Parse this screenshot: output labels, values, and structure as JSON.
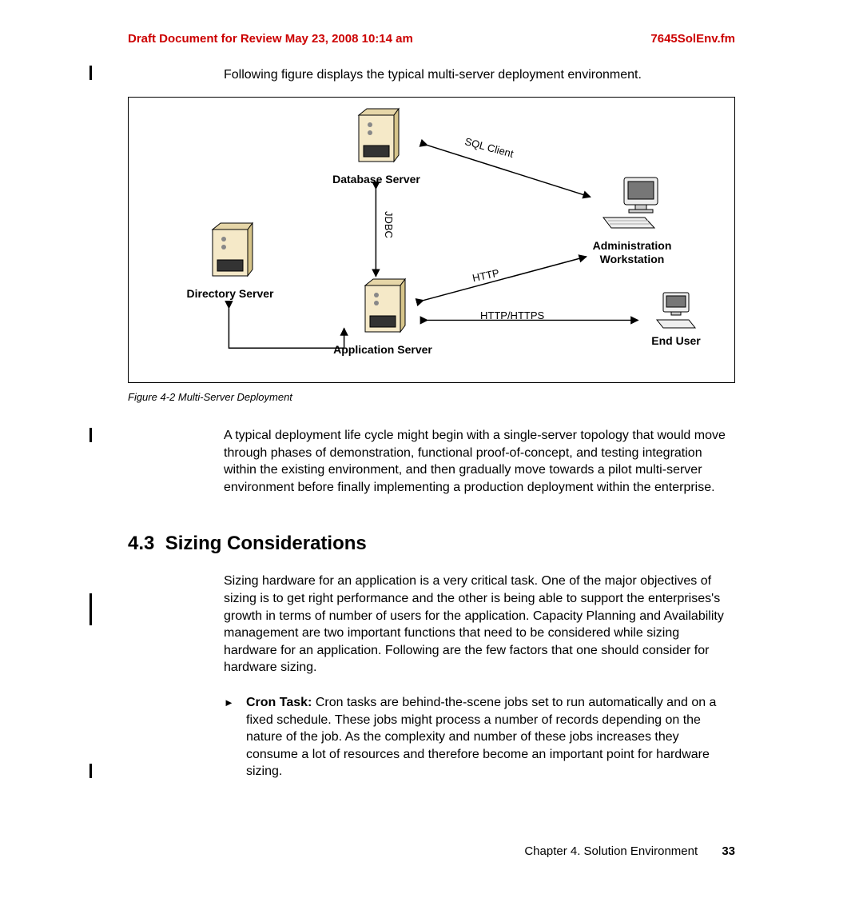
{
  "header": {
    "draft_notice": "Draft Document for Review May 23, 2008 10:14 am",
    "filename": "7645SolEnv.fm"
  },
  "intro": "Following figure displays the typical multi-server deployment environment.",
  "figure": {
    "nodes": {
      "db_server": "Database Server",
      "directory_server": "Directory Server",
      "app_server": "Application Server",
      "admin_ws_line1": "Administration",
      "admin_ws_line2": "Workstation",
      "end_user": "End User"
    },
    "connections": {
      "sql_client": "SQL Client",
      "jdbc": "JDBC",
      "http": "HTTP",
      "http_https": "HTTP/HTTPS"
    },
    "caption": "Figure 4-2   Multi-Server Deployment"
  },
  "para2": "A typical deployment life cycle might begin with a single-server topology that would move through phases of demonstration, functional proof-of-concept, and testing integration within the existing environment, and then gradually move towards a pilot multi-server environment before finally implementing a production deployment within the enterprise.",
  "section": {
    "number": "4.3",
    "title": "Sizing Considerations"
  },
  "para3": "Sizing hardware for an application is a very critical task. One of the major objectives of sizing is to get right performance and the other is being able to support the enterprises's growth in terms of number of users for the application. Capacity Planning and Availability management are two important functions that need to be considered while sizing hardware for an application. Following are the few factors that one should consider for hardware sizing.",
  "bullet1": {
    "bold": "Cron Task:",
    "text": " Cron tasks are behind-the-scene jobs set to run automatically and on a fixed schedule. These jobs might process a number of records depending on the nature of the job. As the complexity and number of these jobs increases they consume a lot of resources and therefore become an important point for hardware sizing."
  },
  "footer": {
    "chapter": "Chapter 4. Solution Environment",
    "page": "33"
  }
}
